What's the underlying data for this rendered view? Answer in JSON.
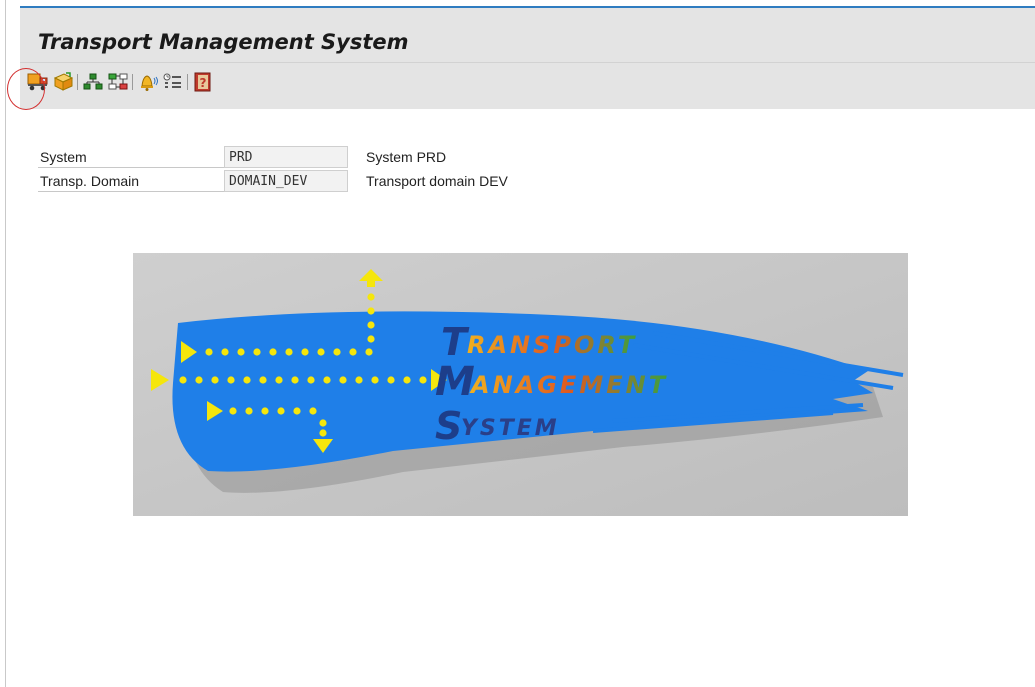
{
  "header": {
    "title": "Transport Management System"
  },
  "toolbar": {
    "buttons": [
      {
        "name": "transport-routes-button",
        "icon": "truck-icon"
      },
      {
        "name": "import-overview-button",
        "icon": "import-icon"
      },
      {
        "name": "system-overview-button",
        "icon": "system-tree-icon"
      },
      {
        "name": "transport-routes-editor-button",
        "icon": "network-icon"
      },
      {
        "name": "alert-monitor-button",
        "icon": "bell-icon"
      },
      {
        "name": "tms-alert-viewer-button",
        "icon": "list-icon"
      },
      {
        "name": "help-button",
        "icon": "help-book-icon"
      }
    ],
    "highlight_color": "#d32f2f"
  },
  "fields": [
    {
      "label": "System",
      "value": "PRD",
      "description": "System PRD"
    },
    {
      "label": "Transp. Domain",
      "value": "DOMAIN_DEV",
      "description": "Transport domain DEV"
    }
  ],
  "banner": {
    "line1_initial": "T",
    "line1_rest": "RANSPORT",
    "line2_initial": "M",
    "line2_rest": "ANAGEMENT",
    "line3_initial": "S",
    "line3_rest": "YSTEM",
    "colors": {
      "brush": "#1f7fe8",
      "arrow": "#f5e60c",
      "initial": "#1d3e8a",
      "rest": "#e98a23"
    }
  },
  "colors": {
    "header_bg": "#e4e4e4",
    "top_line": "#2f7cc0"
  }
}
